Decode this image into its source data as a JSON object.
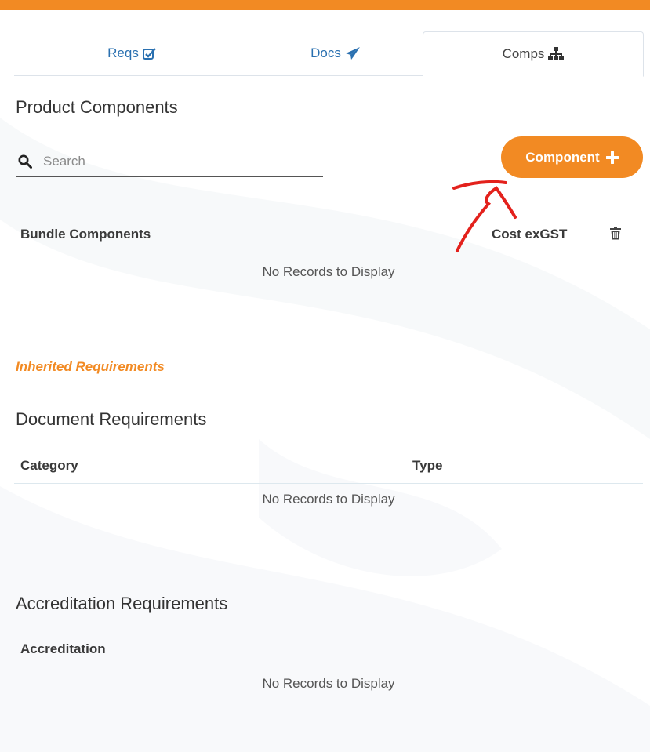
{
  "tabs": [
    {
      "label": "Reqs",
      "icon": "check-square-icon"
    },
    {
      "label": "Docs",
      "icon": "paper-plane-icon"
    },
    {
      "label": "Comps",
      "icon": "sitemap-icon"
    }
  ],
  "product_components": {
    "title": "Product Components",
    "search_placeholder": "Search",
    "add_button_label": "Component",
    "columns": [
      "Bundle Components",
      "Cost exGST"
    ],
    "empty_text": "No Records to Display"
  },
  "inherited_label": "Inherited Requirements",
  "document_requirements": {
    "title": "Document Requirements",
    "columns": [
      "Category",
      "Type"
    ],
    "empty_text": "No Records to Display"
  },
  "accreditation_requirements": {
    "title": "Accreditation Requirements",
    "columns": [
      "Accreditation"
    ],
    "empty_text": "No Records to Display"
  },
  "colors": {
    "accent": "#f28a23",
    "link": "#2a70b0",
    "annotation": "#e3211c"
  }
}
